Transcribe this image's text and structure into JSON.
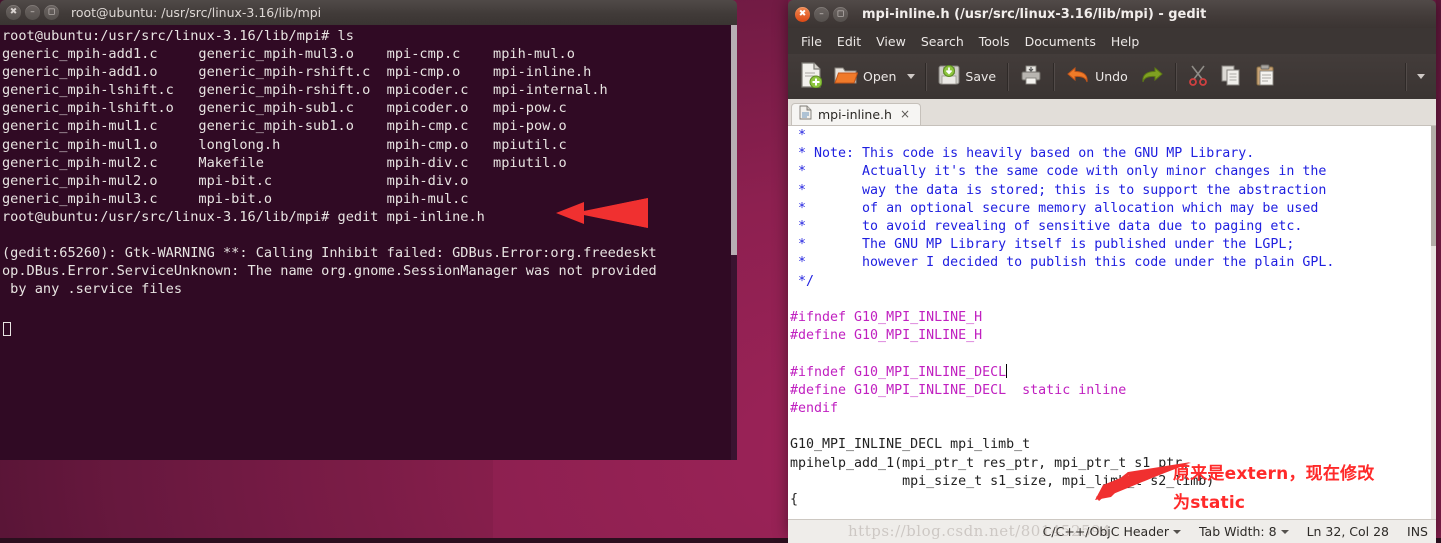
{
  "colors": {
    "terminal_bg": "#300a24",
    "terminal_fg": "#e8e4e2",
    "annotation_red": "#ff2a2a",
    "comment_blue": "#2020e0",
    "preprocessor_magenta": "#c020c0",
    "ubuntu_orange": "#dd4814",
    "desktop_purple": "#8d2050"
  },
  "terminal": {
    "title": "root@ubuntu: /usr/src/linux-3.16/lib/mpi",
    "window_buttons": [
      "close-icon",
      "minimize-icon",
      "maximize-icon"
    ],
    "lines": [
      "root@ubuntu:/usr/src/linux-3.16/lib/mpi# ls",
      "generic_mpih-add1.c     generic_mpih-mul3.o    mpi-cmp.c    mpih-mul.o",
      "generic_mpih-add1.o     generic_mpih-rshift.c  mpi-cmp.o    mpi-inline.h",
      "generic_mpih-lshift.c   generic_mpih-rshift.o  mpicoder.c   mpi-internal.h",
      "generic_mpih-lshift.o   generic_mpih-sub1.c    mpicoder.o   mpi-pow.c",
      "generic_mpih-mul1.c     generic_mpih-sub1.o    mpih-cmp.c   mpi-pow.o",
      "generic_mpih-mul1.o     longlong.h             mpih-cmp.o   mpiutil.c",
      "generic_mpih-mul2.c     Makefile               mpih-div.c   mpiutil.o",
      "generic_mpih-mul2.o     mpi-bit.c              mpih-div.o",
      "generic_mpih-mul3.c     mpi-bit.o              mpih-mul.c",
      "root@ubuntu:/usr/src/linux-3.16/lib/mpi# gedit mpi-inline.h",
      "",
      "(gedit:65260): Gtk-WARNING **: Calling Inhibit failed: GDBus.Error:org.freedeskt",
      "op.DBus.Error.ServiceUnknown: The name org.gnome.SessionManager was not provided",
      " by any .service files"
    ]
  },
  "gedit": {
    "title": "mpi-inline.h (/usr/src/linux-3.16/lib/mpi) - gedit",
    "window_buttons": [
      "close-icon",
      "minimize-icon",
      "maximize-icon"
    ],
    "menu": [
      "File",
      "Edit",
      "View",
      "Search",
      "Tools",
      "Documents",
      "Help"
    ],
    "toolbar": {
      "new_label": "",
      "open_label": "Open",
      "save_label": "Save",
      "print_label": "",
      "undo_label": "Undo",
      "redo_label": "",
      "cut_label": "",
      "copy_label": "",
      "paste_label": ""
    },
    "tab": {
      "label": "mpi-inline.h",
      "close_label": "×"
    },
    "code_lines": [
      {
        "text": " *",
        "style": "comment"
      },
      {
        "text": " * Note: This code is heavily based on the GNU MP Library.",
        "style": "comment"
      },
      {
        "text": " *       Actually it's the same code with only minor changes in the",
        "style": "comment"
      },
      {
        "text": " *       way the data is stored; this is to support the abstraction",
        "style": "comment"
      },
      {
        "text": " *       of an optional secure memory allocation which may be used",
        "style": "comment"
      },
      {
        "text": " *       to avoid revealing of sensitive data due to paging etc.",
        "style": "comment"
      },
      {
        "text": " *       The GNU MP Library itself is published under the LGPL;",
        "style": "comment"
      },
      {
        "text": " *       however I decided to publish this code under the plain GPL.",
        "style": "comment"
      },
      {
        "text": " */",
        "style": "comment"
      },
      {
        "text": "",
        "style": "plain"
      },
      {
        "text": "#ifndef G10_MPI_INLINE_H",
        "style": "pp"
      },
      {
        "text": "#define G10_MPI_INLINE_H",
        "style": "pp"
      },
      {
        "text": "",
        "style": "plain"
      },
      {
        "text": "#ifndef G10_MPI_INLINE_DECL",
        "style": "pp",
        "caret": true
      },
      {
        "text": "#define G10_MPI_INLINE_DECL",
        "style": "pp",
        "suffix": "  static inline",
        "suffix_style": "pp"
      },
      {
        "text": "#endif",
        "style": "pp"
      },
      {
        "text": "",
        "style": "plain"
      },
      {
        "text": "G10_MPI_INLINE_DECL mpi_limb_t",
        "style": "plain"
      },
      {
        "text": "mpihelp_add_1(mpi_ptr_t res_ptr, mpi_ptr_t s1_ptr,",
        "style": "plain"
      },
      {
        "text": "              mpi_size_t s1_size, mpi_limb_t s2_limb)",
        "style": "plain"
      },
      {
        "text": "{",
        "style": "plain"
      }
    ],
    "statusbar": {
      "language": "C/C++/ObjC Header",
      "tab_width": "Tab Width: 8",
      "cursor_position": "Ln 32, Col 28",
      "insert_mode": "INS"
    },
    "watermark": "https://blog.csdn.net/801452594"
  },
  "annotations": {
    "terminal_arrow": "red-arrow-pointing-left-at-gedit-command",
    "gedit_note_line1": "原来是extern，现在修改",
    "gedit_note_line2": "为static"
  }
}
